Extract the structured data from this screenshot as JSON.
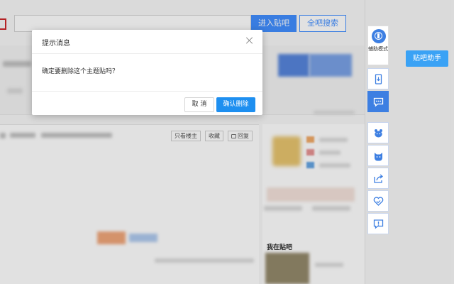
{
  "search": {
    "enter_label": "进入贴吧",
    "all_label": "全吧搜索"
  },
  "thread_tools": {
    "only_op": "只看楼主",
    "favorite": "收藏",
    "reply": "回复"
  },
  "sidebar": {
    "my_tieba": "我在贴吧"
  },
  "toolbar": {
    "assist_label": "辅助模式",
    "icons": [
      "accessibility-icon",
      "mobile-icon",
      "message-icon",
      "bear-icon",
      "cat-icon",
      "share-icon",
      "heart-icon",
      "report-icon"
    ],
    "accent": "#3d7fe2"
  },
  "helper_button": "贴吧助手",
  "dialog": {
    "title": "提示消息",
    "message": "确定要删除这个主题贴吗？",
    "cancel": "取 消",
    "confirm": "确认删除",
    "confirm_color": "#1e8ff0"
  }
}
